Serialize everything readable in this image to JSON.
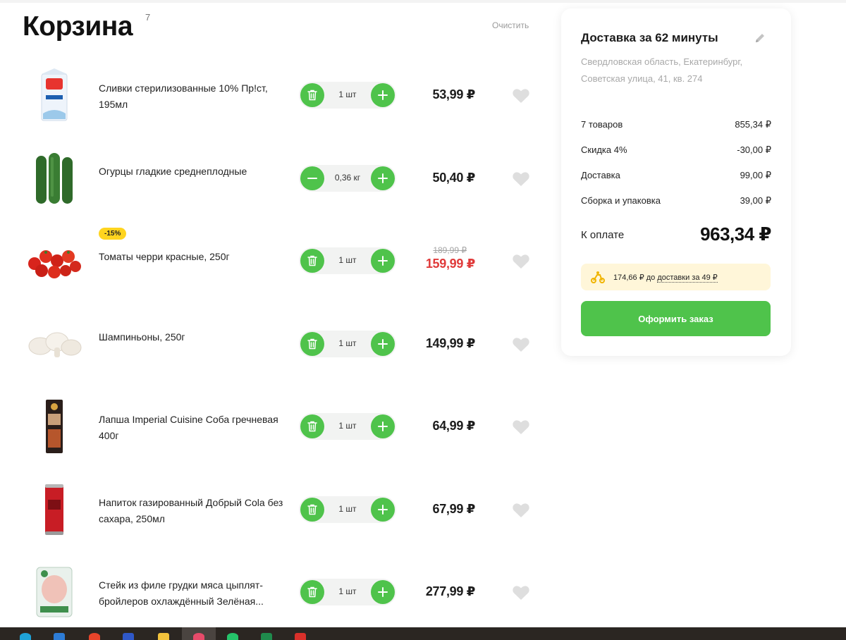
{
  "cart": {
    "title": "Корзина",
    "count": "7",
    "clear_label": "Очистить"
  },
  "items": [
    {
      "name": "Сливки стерилизованные 10% Пр!ст, 195мл",
      "qty": "1 шт",
      "price": "53,99 ₽",
      "left_control": "trash-icon",
      "image": "cream-carton-icon"
    },
    {
      "name": "Огурцы гладкие среднеплодные",
      "qty": "0,36 кг",
      "price": "50,40 ₽",
      "left_control": "minus-icon",
      "image": "cucumber-icon"
    },
    {
      "name": "Томаты черри красные, 250г",
      "badge": "-15%",
      "qty": "1 шт",
      "old_price": "189,99 ₽",
      "price": "159,99 ₽",
      "left_control": "trash-icon",
      "image": "cherry-tomato-icon"
    },
    {
      "name": "Шампиньоны, 250г",
      "qty": "1 шт",
      "price": "149,99 ₽",
      "left_control": "trash-icon",
      "image": "mushroom-icon"
    },
    {
      "name": "Лапша Imperial Cuisine Соба гречневая 400г",
      "qty": "1 шт",
      "price": "64,99 ₽",
      "left_control": "trash-icon",
      "image": "noodles-pack-icon"
    },
    {
      "name": "Напиток газированный Добрый Cola без сахара, 250мл",
      "qty": "1 шт",
      "price": "67,99 ₽",
      "left_control": "trash-icon",
      "image": "cola-can-icon"
    },
    {
      "name": "Стейк из филе грудки мяса цыплят-бройлеров охлаждённый Зелёная...",
      "qty": "1 шт",
      "price": "277,99 ₽",
      "left_control": "trash-icon",
      "image": "chicken-steak-icon"
    }
  ],
  "summary": {
    "delivery_title": "Доставка за 62 минуты",
    "address_line1": "Свердловская область, Екатеринбург,",
    "address_line2": "Советская улица, 41, кв. 274",
    "lines": [
      {
        "label": "7 товаров",
        "value": "855,34 ₽"
      },
      {
        "label": "Скидка 4%",
        "value": "-30,00 ₽"
      },
      {
        "label": "Доставка",
        "value": "99,00 ₽"
      },
      {
        "label": "Сборка и упаковка",
        "value": "39,00 ₽"
      }
    ],
    "pay_label": "К оплате",
    "pay_value": "963,34 ₽",
    "promo_amount": "174,66 ₽ до",
    "promo_link": "доставки за 49 ₽",
    "checkout_label": "Оформить заказ"
  },
  "colors": {
    "accent_green": "#4fc34b",
    "sale_red": "#e03a3a",
    "badge_yellow": "#ffd41f",
    "promo_bg": "#fff6d9"
  }
}
